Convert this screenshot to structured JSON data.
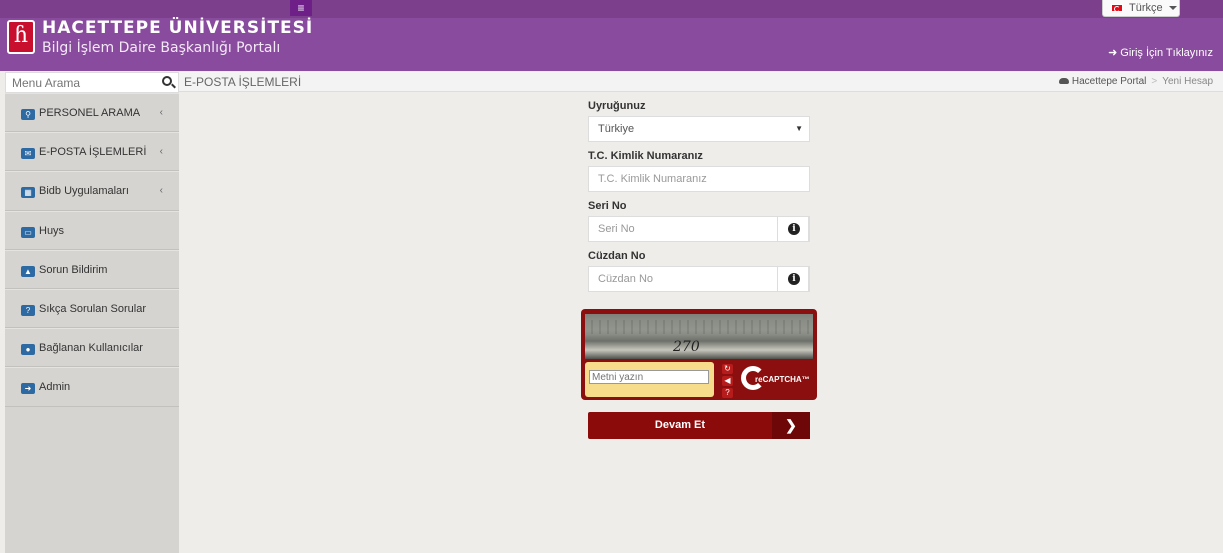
{
  "topbar": {
    "menu_icon": "hamburger-icon",
    "language_label": "Türkçe"
  },
  "header": {
    "title": "HACETTEPE ÜNİVERSİTESİ",
    "subtitle": "Bilgi İşlem Daire Başkanlığı Portalı",
    "login_label": "Giriş İçin Tıklayınız"
  },
  "search": {
    "placeholder": "Menu Arama"
  },
  "page": {
    "title": "E-POSTA İŞLEMLERİ",
    "breadcrumb": [
      "Hacettepe Portal",
      "Yeni Hesap"
    ]
  },
  "sidebar": {
    "items": [
      {
        "label": "PERSONEL ARAMA",
        "icon": "search-icon",
        "expandable": true
      },
      {
        "label": "E-POSTA İŞLEMLERİ",
        "icon": "envelope-icon",
        "expandable": true
      },
      {
        "label": "Bidb Uygulamaları",
        "icon": "grid-icon",
        "expandable": true
      },
      {
        "label": "Huys",
        "icon": "monitor-icon",
        "expandable": false
      },
      {
        "label": "Sorun Bildirim",
        "icon": "warning-icon",
        "expandable": false
      },
      {
        "label": "Sıkça Sorulan Sorular",
        "icon": "question-icon",
        "expandable": false
      },
      {
        "label": "Bağlanan Kullanıcılar",
        "icon": "comments-icon",
        "expandable": false
      },
      {
        "label": "Admin",
        "icon": "sign-in-icon",
        "expandable": false
      }
    ]
  },
  "form": {
    "nationality": {
      "label": "Uyruğunuz",
      "value": "Türkiye"
    },
    "tc": {
      "label": "T.C. Kimlik Numaranız",
      "placeholder": "T.C. Kimlik Numaranız"
    },
    "serial": {
      "label": "Seri No",
      "placeholder": "Seri No"
    },
    "wallet": {
      "label": "Cüzdan No",
      "placeholder": "Cüzdan No"
    },
    "submit_label": "Devam Et"
  },
  "captcha": {
    "image_text": "270",
    "input_placeholder": "Metni yazın",
    "logo_text": "reCAPTCHA™"
  },
  "colors": {
    "header": "#894b9d",
    "topbar": "#7b3f8c",
    "accent": "#8b0b0b",
    "sidebar": "#d6d4d1"
  }
}
